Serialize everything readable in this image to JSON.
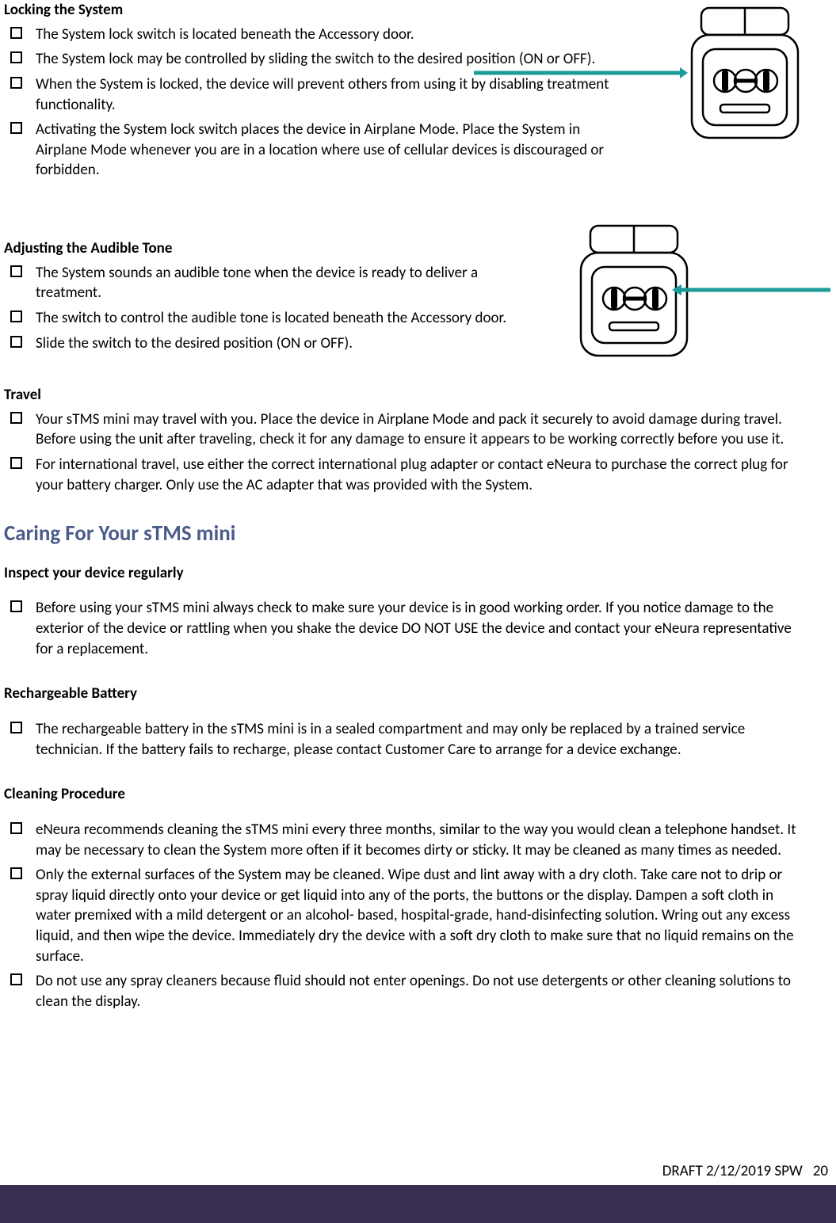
{
  "sections": {
    "locking": {
      "heading": "Locking the System",
      "items": [
        "The System lock switch is located beneath the Accessory door.",
        "The System lock may be controlled by sliding the switch to the desired position (ON or OFF).",
        "When the System is locked, the device will prevent others from using it by disabling treatment functionality.",
        "Activating the System lock switch places the device in Airplane Mode.  Place the System in Airplane Mode whenever you are in a location where use of cellular devices is discouraged or forbidden."
      ]
    },
    "audible": {
      "heading": "Adjusting the Audible Tone",
      "items": [
        "The System sounds an audible tone when the device is ready to deliver a treatment.",
        "The switch to control the audible tone is located beneath the Accessory door.",
        "Slide the switch to the desired position (ON or OFF)."
      ]
    },
    "travel": {
      "heading": "Travel",
      "items": [
        "Your sTMS mini may travel with you.  Place the device in Airplane Mode and pack it securely to avoid damage during travel.  Before using the unit after traveling, check it for any damage to ensure it appears to be working correctly before you use it.",
        "For international travel, use either the correct international plug adapter or contact eNeura to purchase the correct plug for your battery charger. Only use the AC adapter that was provided with the System."
      ]
    },
    "caring_heading": "Caring For Your sTMS mini",
    "inspect": {
      "heading": "Inspect your device regularly",
      "items": [
        "Before using your sTMS mini always check to make sure your device is in good working order.  If you notice damage to the exterior of the device or rattling when you shake the device DO NOT USE the device and contact your eNeura representative for a replacement."
      ]
    },
    "battery": {
      "heading": "Rechargeable Battery",
      "items": [
        "The rechargeable battery in the sTMS mini is in a sealed compartment and may only be replaced by a trained service technician.  If the battery fails to recharge, please contact Customer Care to arrange for a device exchange."
      ]
    },
    "cleaning": {
      "heading": "Cleaning Procedure",
      "items": [
        "eNeura recommends cleaning the sTMS mini every three months, similar to the way you would clean a telephone handset.  It may be necessary to clean the System more often if it becomes dirty or sticky.  It may be cleaned as many times as needed.",
        "Only the external surfaces of the System may be cleaned.   Wipe dust and lint away with a dry cloth.  Take care not to drip or spray liquid directly onto your device or get liquid into any of the ports, the buttons or the display.  Dampen a soft cloth in water premixed with a mild detergent or an alcohol- based, hospital-grade, hand-disinfecting solution.  Wring out any excess liquid, and then wipe the device.  Immediately dry the device with a soft dry cloth to make sure that no liquid remains on the surface.",
        "Do not use any spray cleaners because fluid should not enter openings.  Do not use detergents or other cleaning solutions to clean the display."
      ]
    }
  },
  "footer": {
    "text": "DRAFT 2/12/2019 SPW",
    "page": "20"
  }
}
